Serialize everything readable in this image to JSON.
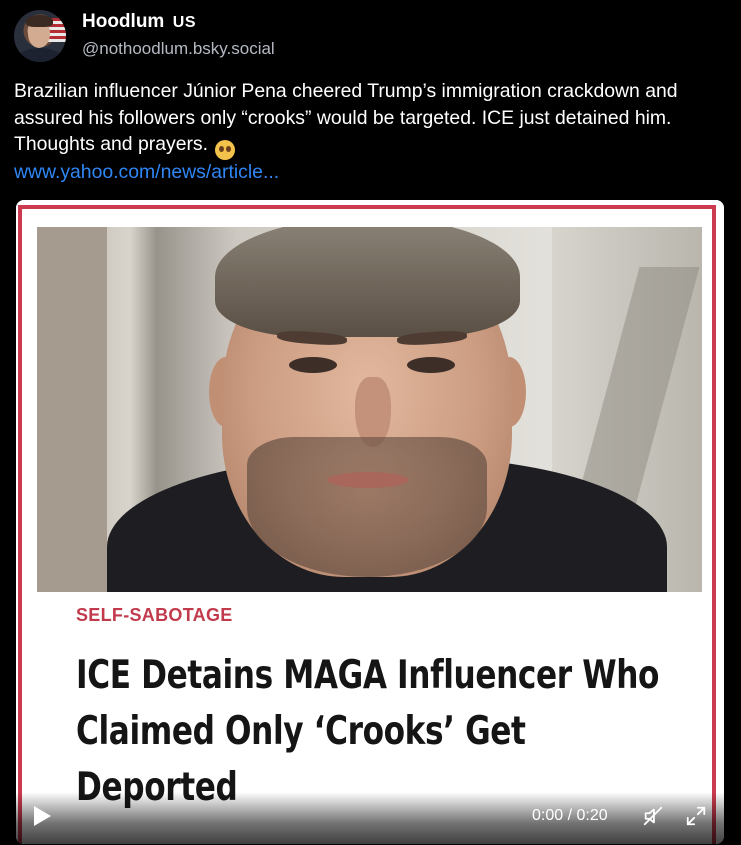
{
  "author": {
    "display_name": "Hoodlum",
    "tag": "US",
    "handle": "@nothoodlum.bsky.social"
  },
  "post": {
    "text": "Brazilian influencer Júnior Pena cheered Trump’s immigration crackdown and assured his followers only “crooks” would be targeted. ICE just detained him. Thoughts and prayers.",
    "emoji": "pleading-face",
    "link": "www.yahoo.com/news/article..."
  },
  "media": {
    "kicker": "SELF-SABOTAGE",
    "headline": "ICE Detains MAGA Influencer Who Claimed Only ‘Crooks’ Get Deported",
    "player": {
      "time": "0:00 / 0:20",
      "play_icon": "play-icon",
      "mute_icon": "muted-speaker-icon",
      "fullscreen_icon": "fullscreen-icon"
    }
  },
  "colors": {
    "background": "#000000",
    "link": "#2f86f5",
    "handle": "#b4b9c2",
    "card_border": "#cc3a4f",
    "kicker": "#c23b4d"
  }
}
